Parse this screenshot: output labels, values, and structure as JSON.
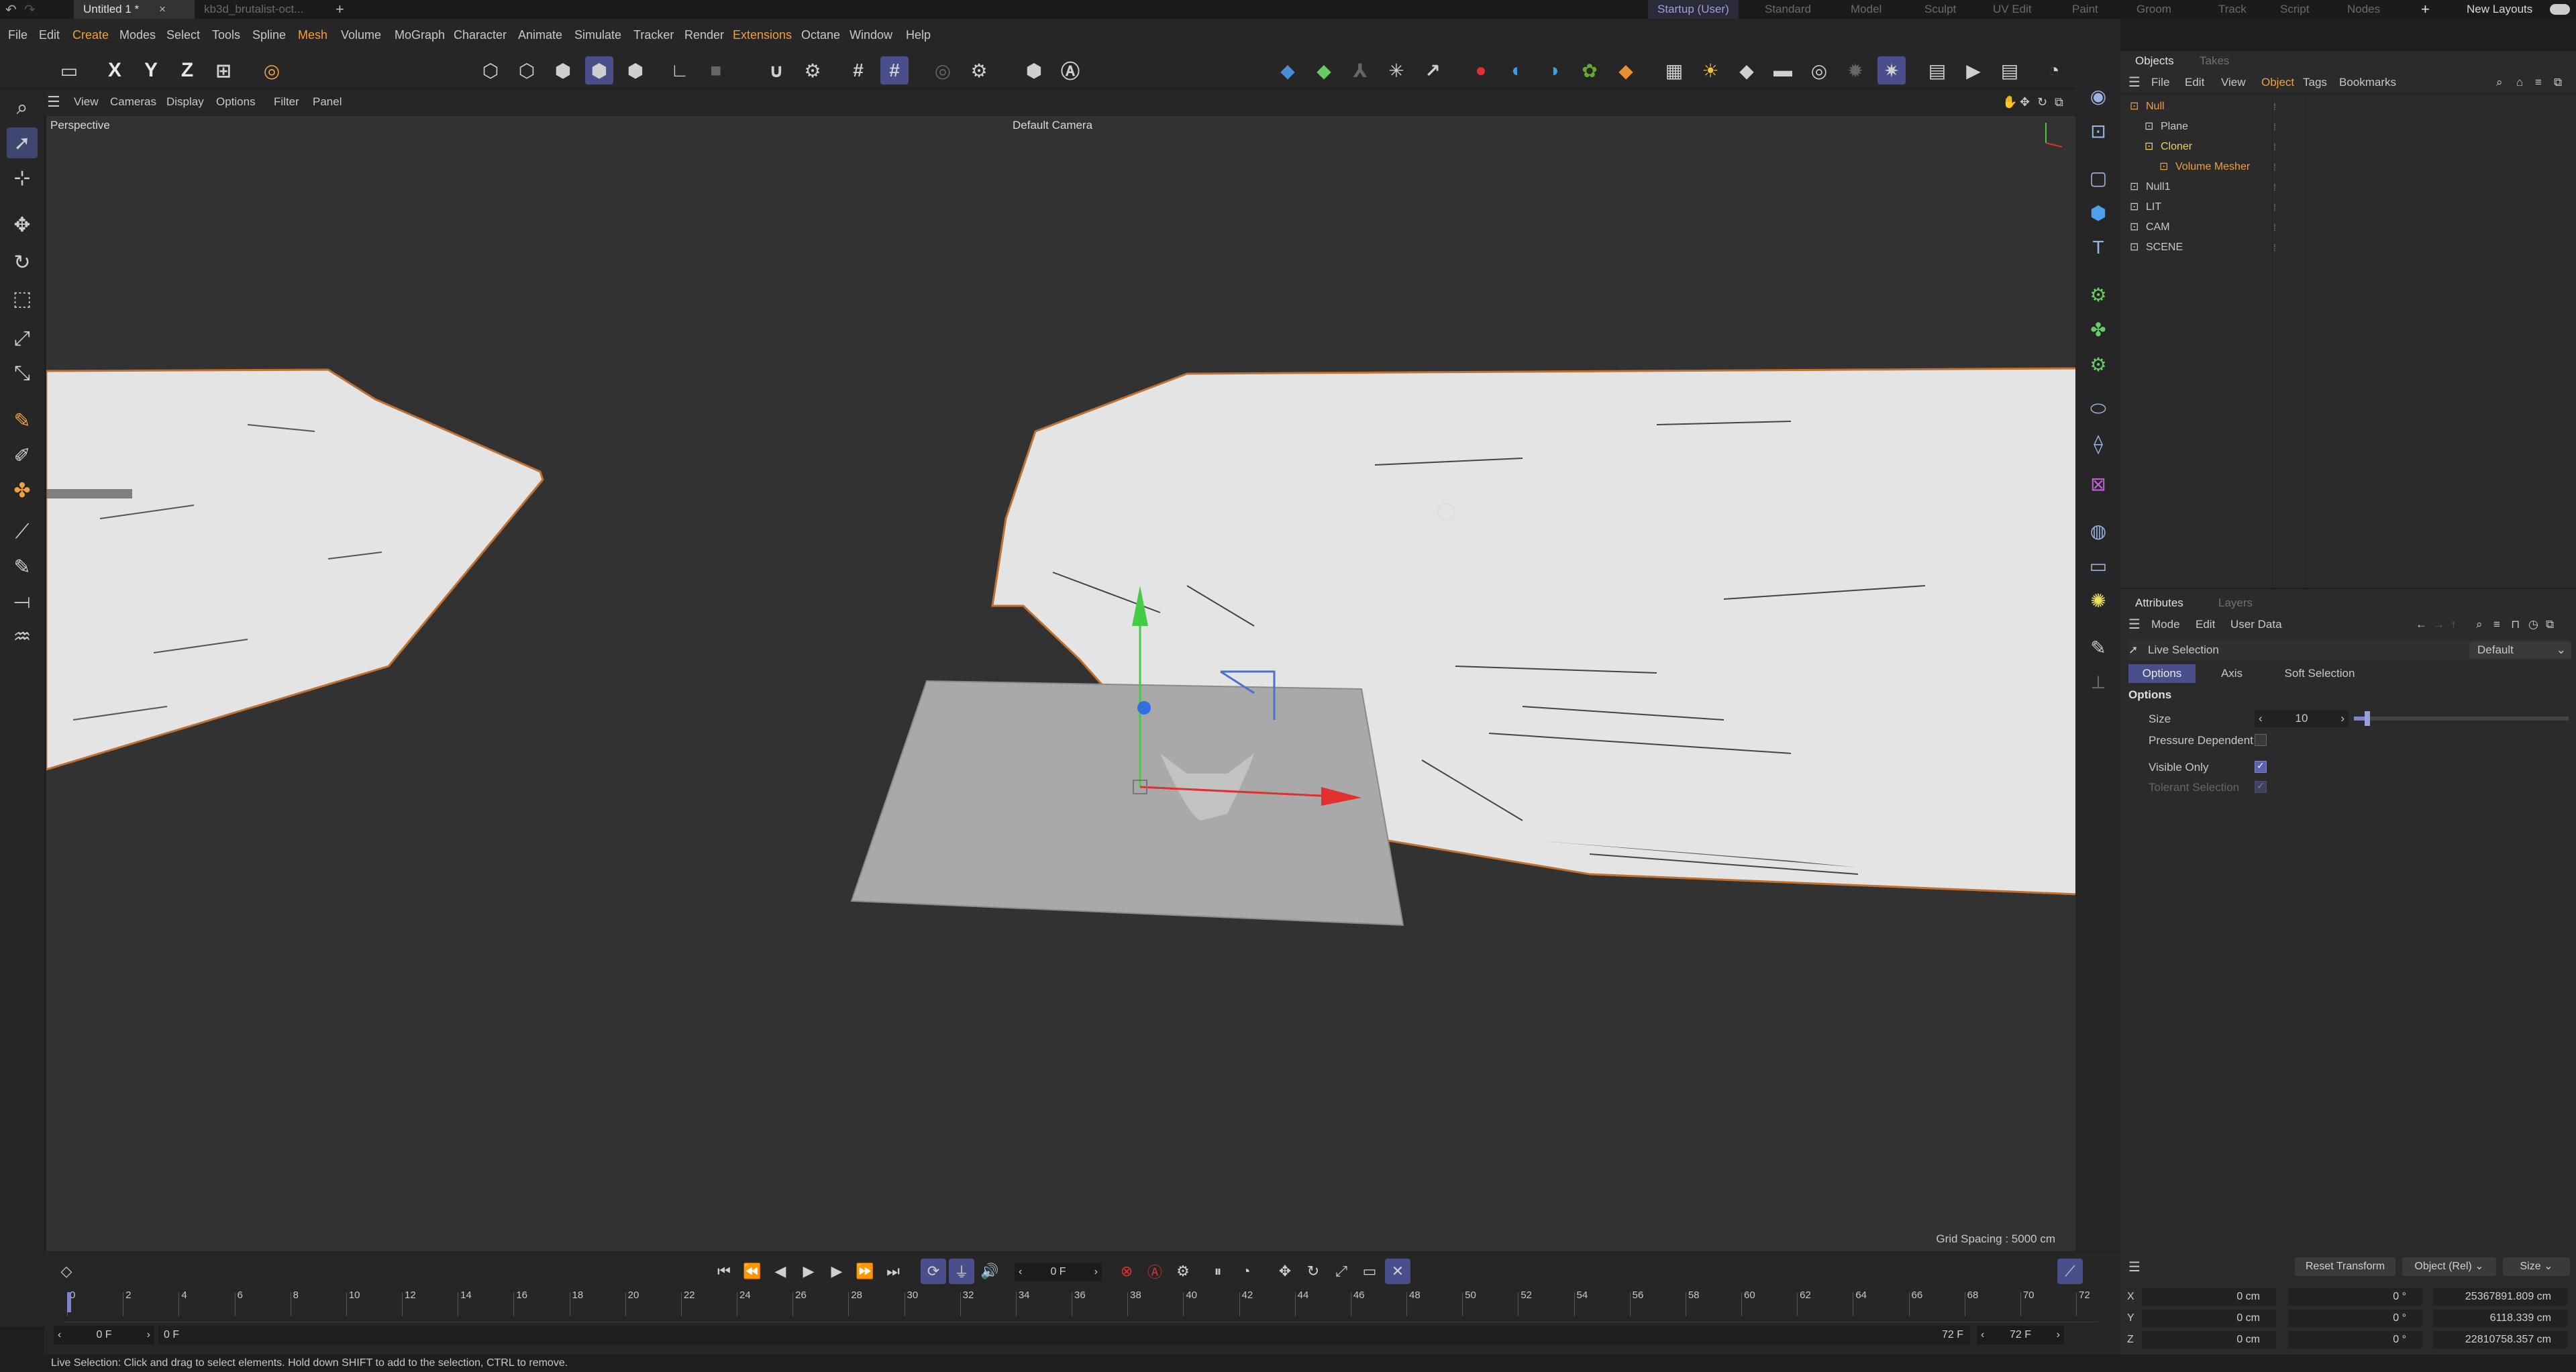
{
  "titlebar": {
    "tabs": [
      "Untitled 1 *",
      "kb3d_brutalist-oct..."
    ],
    "close_glyph": "×",
    "add_glyph": "+",
    "layouts": [
      "Startup (User)",
      "Standard",
      "Model",
      "Sculpt",
      "UV Edit",
      "Paint",
      "Groom",
      "Track",
      "Script",
      "Nodes"
    ],
    "new_layouts": "New Layouts"
  },
  "menubar": [
    "File",
    "Edit",
    "Create",
    "Modes",
    "Select",
    "Tools",
    "Spline",
    "Mesh",
    "Volume",
    "MoGraph",
    "Character",
    "Animate",
    "Simulate",
    "Tracker",
    "Render",
    "Extensions",
    "Octane",
    "Window",
    "Help"
  ],
  "toolbar": {
    "axis_x": "X",
    "axis_y": "Y",
    "axis_z": "Z"
  },
  "viewport": {
    "menu": [
      "View",
      "Cameras",
      "Display",
      "Options",
      "Filter",
      "Panel"
    ],
    "projection": "Perspective",
    "camera": "Default Camera",
    "grid_spacing": "Grid Spacing : 5000 cm"
  },
  "objects_panel": {
    "tabs": [
      "Objects",
      "Takes"
    ],
    "menu": [
      "File",
      "Edit",
      "View",
      "Object",
      "Tags",
      "Bookmarks"
    ],
    "items": [
      {
        "name": "Null",
        "color": "#f0a03c",
        "indent": 0
      },
      {
        "name": "Plane",
        "color": "#c8c8c8",
        "indent": 1
      },
      {
        "name": "Cloner",
        "color": "#f0d060",
        "indent": 1
      },
      {
        "name": "Volume Mesher",
        "color": "#f0a03c",
        "indent": 2
      },
      {
        "name": "Null1",
        "color": "#c8c8c8",
        "indent": 0
      },
      {
        "name": "LIT",
        "color": "#c8c8c8",
        "indent": 0
      },
      {
        "name": "CAM",
        "color": "#c8c8c8",
        "indent": 0
      },
      {
        "name": "SCENE",
        "color": "#c8c8c8",
        "indent": 0
      }
    ]
  },
  "attributes": {
    "tabs": [
      "Attributes",
      "Layers"
    ],
    "menu": [
      "Mode",
      "Edit",
      "User Data"
    ],
    "tool": "Live Selection",
    "preset": "Default",
    "subtabs": [
      "Options",
      "Axis",
      "Soft Selection"
    ],
    "section": "Options",
    "size_label": "Size",
    "size_value": "10",
    "size_fraction": 0.05,
    "pressure_label": "Pressure Dependent",
    "visible_only_label": "Visible Only",
    "tolerant_label": "Tolerant Selection"
  },
  "coords": {
    "reset": "Reset Transform",
    "mode": "Object (Rel)",
    "size_mode": "Size",
    "rows": [
      {
        "axis": "X",
        "pos": "0 cm",
        "rot": "0 °",
        "size": "25367891.809 cm"
      },
      {
        "axis": "Y",
        "pos": "0 cm",
        "rot": "0 °",
        "size": "6118.339 cm"
      },
      {
        "axis": "Z",
        "pos": "0 cm",
        "rot": "0 °",
        "size": "22810758.357 cm"
      }
    ]
  },
  "timeline": {
    "current_frame": "0 F",
    "start_field": "0 F",
    "offset_field": "0 F",
    "end_field": "72 F",
    "end_field2": "72 F",
    "ticks": [
      "0",
      "2",
      "4",
      "6",
      "8",
      "10",
      "12",
      "14",
      "16",
      "18",
      "20",
      "22",
      "24",
      "26",
      "28",
      "30",
      "32",
      "34",
      "36",
      "38",
      "40",
      "42",
      "44",
      "46",
      "48",
      "50",
      "52",
      "54",
      "56",
      "58",
      "60",
      "62",
      "64",
      "66",
      "68",
      "70",
      "72"
    ]
  },
  "statusbar": "Live Selection: Click and drag to select elements. Hold down SHIFT to add to the selection, CTRL to remove.",
  "colors": {
    "accent": "#4a4f8c",
    "orange": "#f0a03c"
  }
}
